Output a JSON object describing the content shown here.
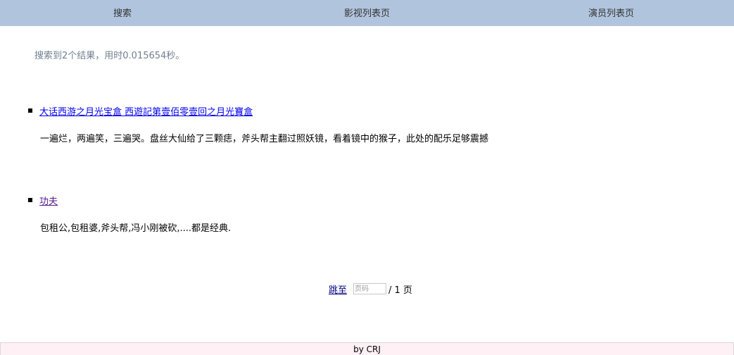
{
  "nav": {
    "items": [
      {
        "label": "搜索"
      },
      {
        "label": "影视列表页"
      },
      {
        "label": "演员列表页"
      }
    ]
  },
  "search": {
    "summary": "搜索到2个结果，用时0.015654秒。"
  },
  "results": [
    {
      "title": "大话西游之月光宝盒 西遊記第壹佰零壹回之月光寶盒",
      "description": "一遍烂，两遍笑，三遍哭。盘丝大仙给了三颗痣，斧头帮主翻过照妖镜，看着镜中的猴子，此处的配乐足够震撼",
      "link_color": "#0000ee"
    },
    {
      "title": "功夫",
      "description": "包租公,包租婆,斧头帮,冯小刚被砍,....都是经典.",
      "link_color": "#551a8b"
    }
  ],
  "pager": {
    "jump_label": "跳至",
    "input_placeholder": "页码",
    "input_value": "",
    "total_text": "/ 1 页"
  },
  "footer": {
    "text": "by CRJ"
  },
  "colors": {
    "nav_bg": "#b0c4de",
    "summary_text": "#708090",
    "footer_bg": "#fff0f5"
  }
}
